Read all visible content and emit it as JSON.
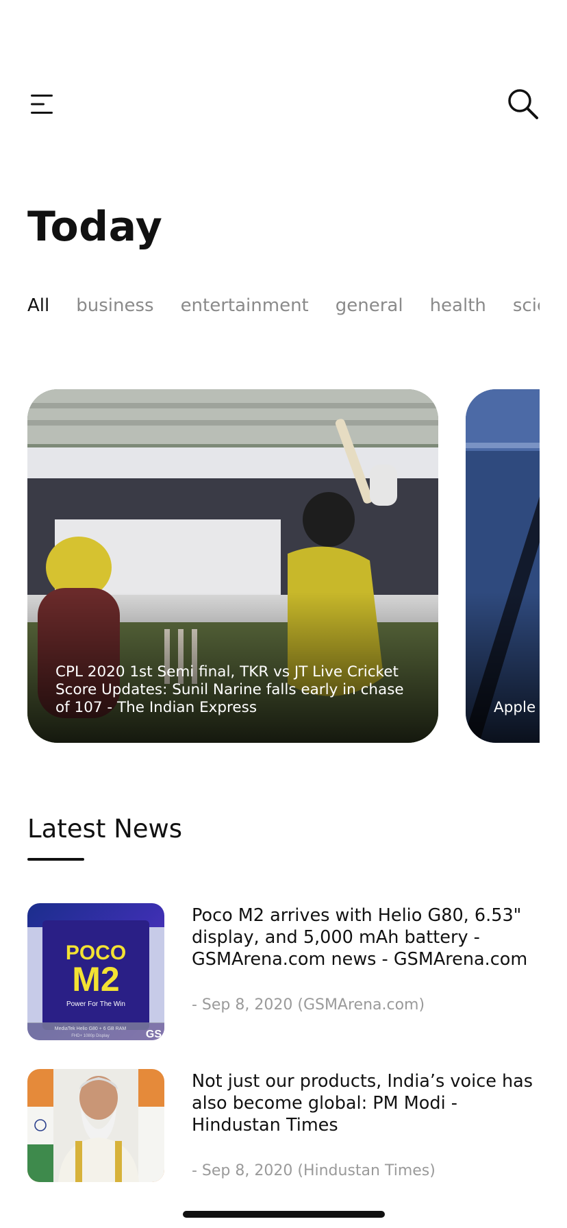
{
  "header": {
    "menu_icon": "menu-icon",
    "search_icon": "search-icon"
  },
  "page": {
    "title": "Today"
  },
  "categories": {
    "items": [
      "All",
      "business",
      "entertainment",
      "general",
      "health",
      "scie"
    ],
    "active": "All"
  },
  "carousel": {
    "cards": [
      {
        "caption": "CPL 2020 1st Semi final, TKR vs JT Live Cricket Score Updates: Sunil Narine falls early in chase of 107 - The Indian Express"
      },
      {
        "caption": "Apple launch"
      }
    ]
  },
  "latest": {
    "title": "Latest News",
    "items": [
      {
        "title": "Poco M2 arrives with Helio G80, 6.53\" display, and 5,000 mAh battery - GSMArena.com news - GSMArena.com",
        "meta": "- Sep 8, 2020 (GSMArena.com)",
        "thumb_text_1": "POCO",
        "thumb_text_2": "M2",
        "thumb_text_3": "Power For The Win",
        "thumb_text_4": "MediaTek Helio G80 + 6 GB RAM",
        "thumb_text_5": "FHD+ 1080p Display",
        "thumb_text_6": "GS"
      },
      {
        "title": "Not just our products, India’s voice has also become global: PM Modi - Hindustan Times",
        "meta": "- Sep 8, 2020 (Hindustan Times)"
      }
    ]
  },
  "colors": {
    "text_primary": "#111111",
    "text_muted": "#8a8a8a",
    "background": "#ffffff"
  }
}
